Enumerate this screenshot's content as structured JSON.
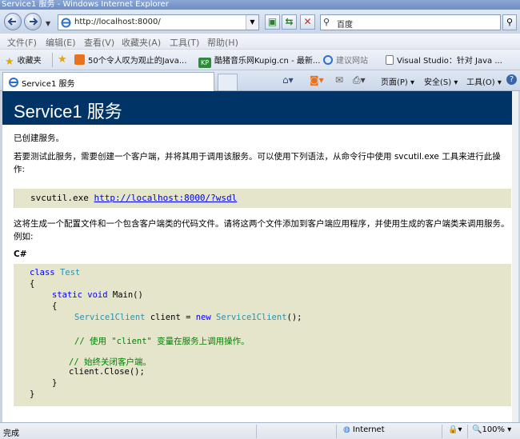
{
  "window": {
    "title": "Service1 服务 - Windows Internet Explorer"
  },
  "addressbar": {
    "url": "http://localhost:8000/"
  },
  "search": {
    "placeholder": "百度"
  },
  "menu": [
    "文件(F)",
    "编辑(E)",
    "查看(V)",
    "收藏夹(A)",
    "工具(T)",
    "帮助(H)"
  ],
  "favorites": {
    "label": "收藏夹",
    "items": [
      "50个令人叹为观止的Java...",
      "酷猪音乐网Kupig.cn - 最新...",
      "建议网站",
      "Visual Studio：针对 Java ..."
    ]
  },
  "tab": {
    "label": "Service1 服务"
  },
  "commandbar": {
    "page": "页面(P)",
    "safety": "安全(S)",
    "tools": "工具(O)"
  },
  "content": {
    "heading": "Service1 服务",
    "created": "已创建服务。",
    "intro": "若要测试此服务，需要创建一个客户端，并将其用于调用该服务。可以使用下列语法，从命令行中使用 svcutil.exe 工具来进行此操作:",
    "svcutil_cmd": "svcutil.exe ",
    "svcutil_link": "http://localhost:8000/?wsdl",
    "desc": "这将生成一个配置文件和一个包含客户端类的代码文件。请将这两个文件添加到客户端应用程序，并使用生成的客户端类来调用服务。例如:",
    "lang": "C#",
    "code": {
      "class_kw": "class",
      "class_name": "Test",
      "open1": "{",
      "static_kw": "static",
      "void_kw": "void",
      "main": " Main()",
      "open2": "{",
      "client_type": "Service1Client",
      "client_mid": " client = ",
      "new_kw": "new",
      "client_ctor": " Service1Client",
      "client_end": "();",
      "comment1": "// 使用 \"client\" 变量在服务上调用操作。",
      "comment2": "// 始终关闭客户端。",
      "close_call": "client.Close();",
      "close2": "}",
      "close1": "}"
    }
  },
  "status": {
    "text": "完成",
    "zone": "Internet",
    "zoom": "100%"
  }
}
